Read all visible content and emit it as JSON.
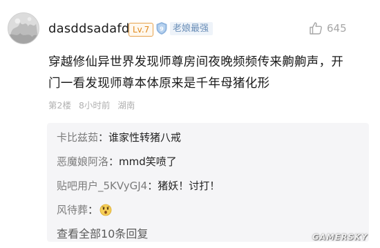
{
  "post": {
    "username": "dasddsadafds",
    "level": "Lv.7",
    "title_badge": "老娘最强",
    "like_count": "645",
    "content_lines": [
      "穿越修仙异世界发现师尊房间夜晚频频传来齁齁声，开",
      "门一看发现师尊本体原来是千年母猪化形"
    ],
    "meta": {
      "floor": "第2楼",
      "time": "8小时前",
      "location": "湖南"
    }
  },
  "replies": [
    {
      "user": "卡比兹茹",
      "sep": "：",
      "text": "谁家性转猪八戒"
    },
    {
      "user": "恶魔娘阿洛",
      "sep": "：",
      "text": "mmd笑喷了"
    },
    {
      "user": "贴吧用户_5KVyGJ4",
      "sep": "：",
      "text": "猪妖！讨打！"
    },
    {
      "user": "风待葬",
      "sep": "：",
      "text": "",
      "emoji": "surprised-face-icon"
    }
  ],
  "view_all_label": "查看全部10条回复",
  "watermark": "GAMERSKY",
  "colors": {
    "level_badge": "#e08a1e",
    "title_badge": "#6b8fb8",
    "reply_user": "#7b7b7b",
    "meta_text": "#b0b0b0",
    "reply_background": "#f5f5f7"
  },
  "icons": {
    "like": "thumbs-up-icon",
    "badge": "shield-badge-icon"
  }
}
